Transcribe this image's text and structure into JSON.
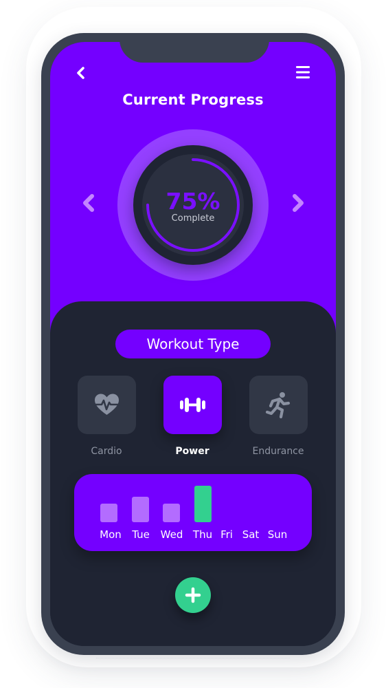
{
  "header": {
    "title": "Current Progress",
    "back_icon": "chevron-left-icon",
    "menu_icon": "hamburger-menu-icon"
  },
  "progress": {
    "value_label": "75%",
    "fraction": 0.75,
    "sub_label": "Complete",
    "prev_icon": "chevron-left-icon",
    "next_icon": "chevron-right-icon"
  },
  "workout_type": {
    "title": "Workout Type",
    "options": [
      {
        "label": "Cardio",
        "icon": "heart-pulse-icon",
        "selected": false
      },
      {
        "label": "Power",
        "icon": "dumbbell-icon",
        "selected": true
      },
      {
        "label": "Endurance",
        "icon": "running-person-icon",
        "selected": false
      }
    ]
  },
  "week": {
    "days": [
      {
        "label": "Mon",
        "level": 0.5,
        "active": false
      },
      {
        "label": "Tue",
        "level": 0.7,
        "active": false
      },
      {
        "label": "Wed",
        "level": 0.5,
        "active": false
      },
      {
        "label": "Thu",
        "level": 1.0,
        "active": true
      },
      {
        "label": "Fri",
        "level": 0,
        "active": false
      },
      {
        "label": "Sat",
        "level": 0,
        "active": false
      },
      {
        "label": "Sun",
        "level": 0,
        "active": false
      }
    ]
  },
  "add_button": {
    "icon": "plus-icon"
  },
  "colors": {
    "accent": "#7400ff",
    "background": "#1f2433",
    "success": "#33d08f",
    "bar_inactive": "#b36cff"
  }
}
